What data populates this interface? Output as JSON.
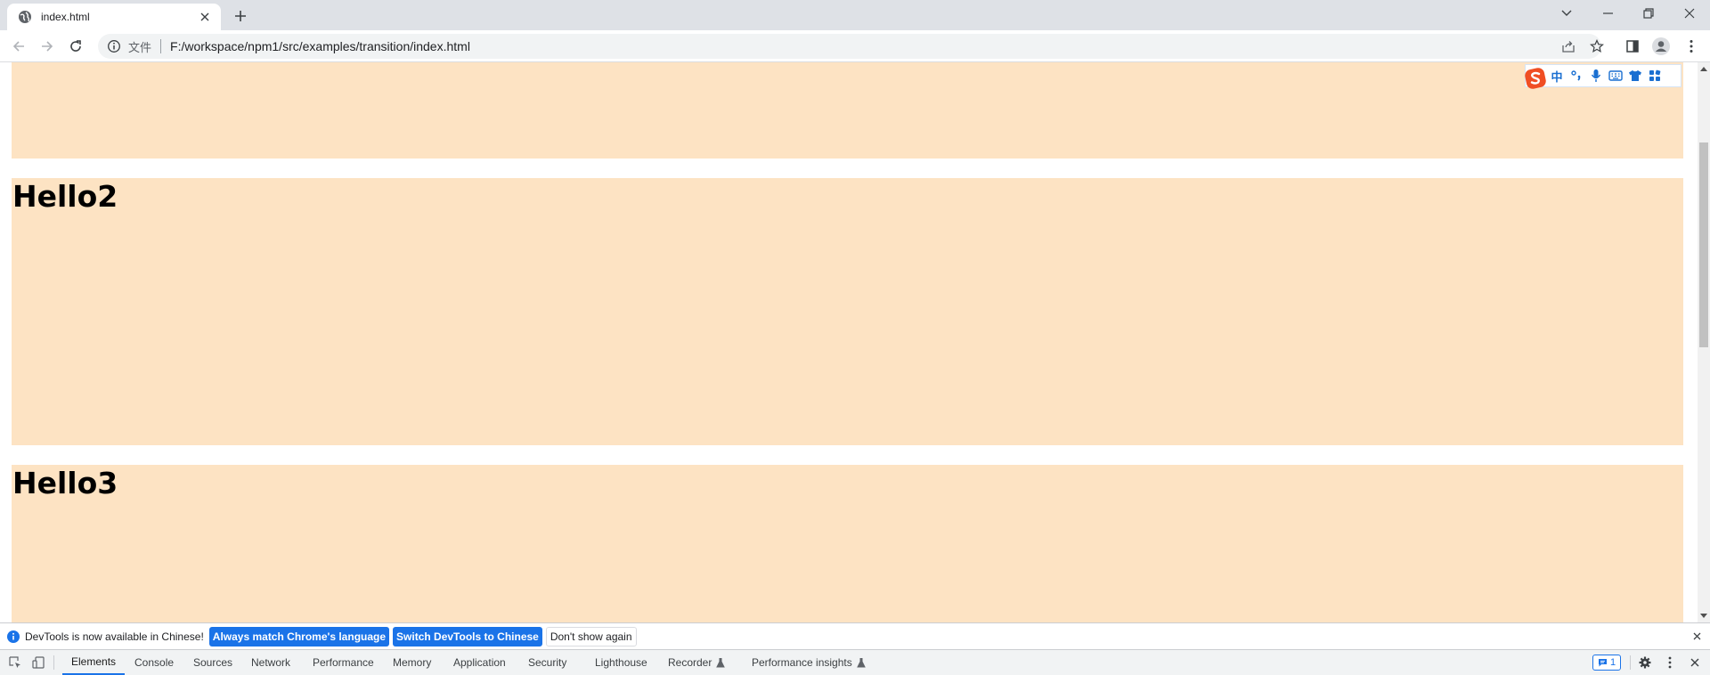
{
  "browser": {
    "tab_title": "index.html",
    "address": {
      "scheme_label": "文件",
      "url": "F:/workspace/npm1/src/examples/transition/index.html"
    }
  },
  "page": {
    "background": "#fde3c3",
    "headings": [
      "Hello2",
      "Hello3"
    ]
  },
  "ime_toolbar": {
    "items": [
      "中",
      "°,",
      "mic",
      "keyboard",
      "shirt",
      "grid"
    ]
  },
  "devtools": {
    "infobar": {
      "message": "DevTools is now available in Chinese!",
      "primary_button_1": "Always match Chrome's language",
      "primary_button_2": "Switch DevTools to Chinese",
      "secondary_button": "Don't show again"
    },
    "tabs": [
      "Elements",
      "Console",
      "Sources",
      "Network",
      "Performance",
      "Memory",
      "Application",
      "Security",
      "Lighthouse",
      "Recorder",
      "Performance insights"
    ],
    "active_tab": "Elements",
    "issues_count": "1"
  }
}
